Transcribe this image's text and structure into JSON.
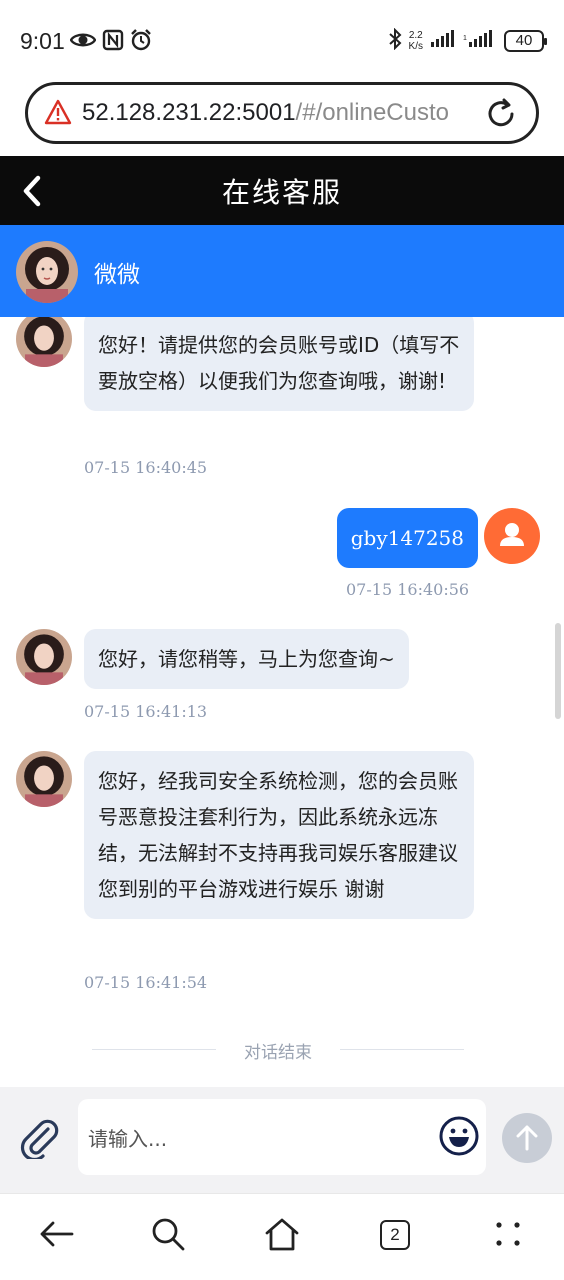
{
  "status_bar": {
    "time": "9:01",
    "net_speed_value": "2.2",
    "net_speed_unit": "K/s",
    "battery": "40",
    "icons": [
      "eye-icon",
      "nfc-icon",
      "alarm-icon",
      "bluetooth-icon",
      "signal-icon",
      "signal-icon-2"
    ]
  },
  "browser": {
    "url_host": "52.128.231.22:5001",
    "url_path": "/#/onlineCusto",
    "icons": [
      "not-secure-warning-icon",
      "reload-icon"
    ]
  },
  "header": {
    "title": "在线客服",
    "back_icon": "chevron-left-icon"
  },
  "agent": {
    "name": "微微"
  },
  "messages": [
    {
      "from": "agent",
      "text": "您好！请提供您的会员账号或ID（填写不要放空格）以便我们为您查询哦，谢谢!",
      "time": "07-15 16:40:45"
    },
    {
      "from": "user",
      "text": "gby147258",
      "time": "07-15 16:40:56"
    },
    {
      "from": "agent",
      "text": "您好，请您稍等，马上为您查询~",
      "time": "07-15 16:41:13"
    },
    {
      "from": "agent",
      "text": "您好，经我司安全系统检测，您的会员账号恶意投注套利行为，因此系统永远冻结，无法解封不支持再我司娱乐客服建议您到别的平台游戏进行娱乐 谢谢",
      "time": "07-15 16:41:54"
    }
  ],
  "conversation_end": "对话结束",
  "composer": {
    "placeholder": "请输入...",
    "icons": [
      "paperclip-icon",
      "emoji-icon",
      "send-arrow-icon"
    ]
  },
  "bottom_nav": {
    "tab_count": "2",
    "icons": [
      "back-arrow-icon",
      "search-icon",
      "home-icon",
      "tabs-icon",
      "menu-dots-icon"
    ]
  },
  "colors": {
    "header_bg": "#0b0b0b",
    "agent_bar": "#1e7bfe",
    "user_bubble": "#1e7bfe",
    "agent_bubble": "#e9eef6",
    "user_avatar": "#ff6b35"
  }
}
